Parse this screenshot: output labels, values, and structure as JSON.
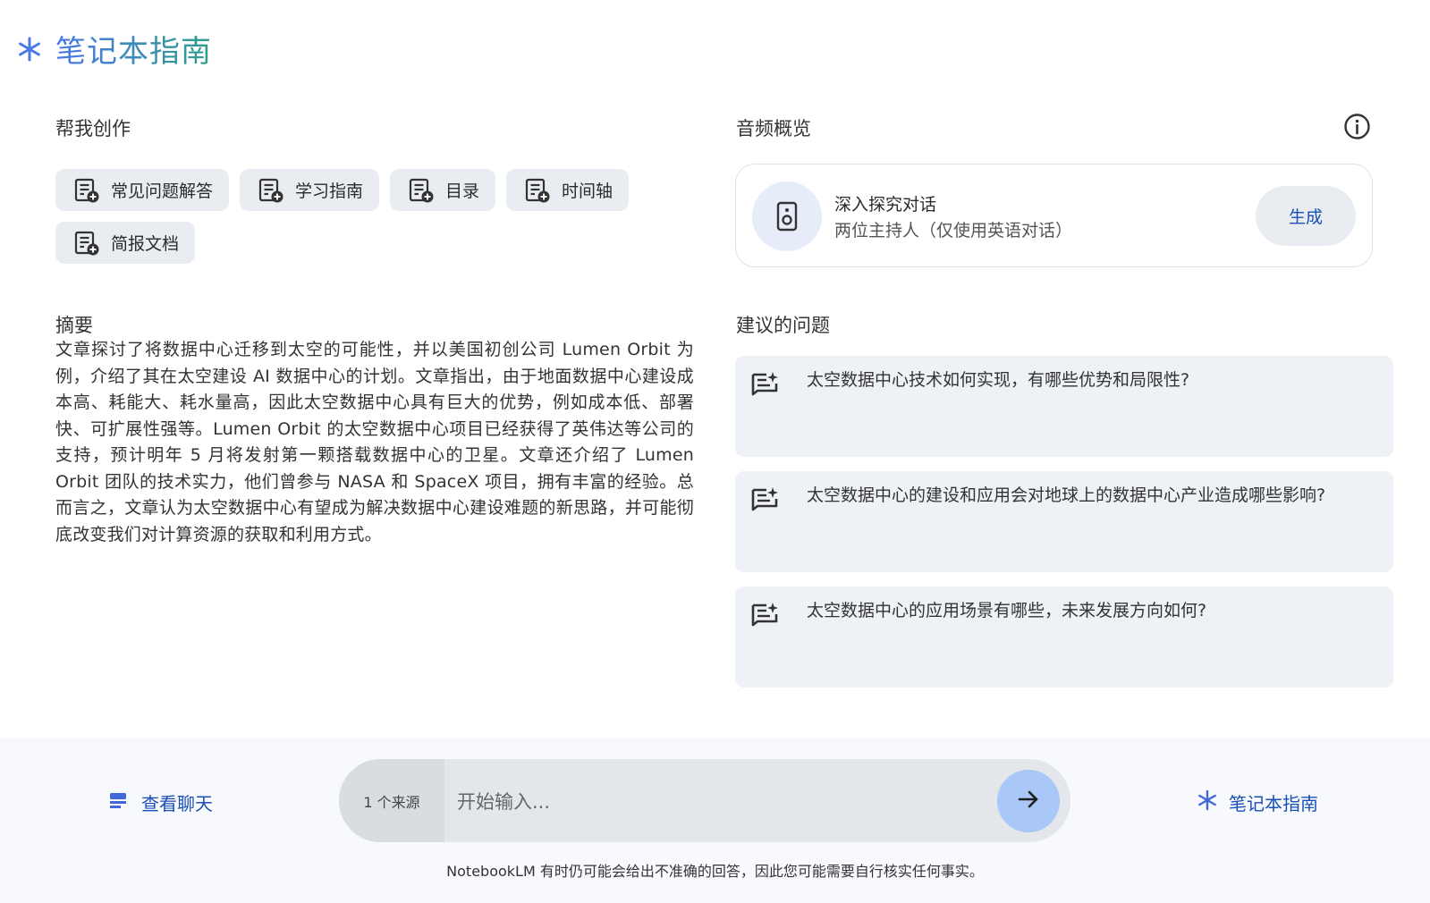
{
  "header": {
    "title": "笔记本指南",
    "icon": "spark-icon"
  },
  "create": {
    "title": "帮我创作",
    "chips": [
      {
        "label": "常见问题解答",
        "icon": "note-add-icon"
      },
      {
        "label": "学习指南",
        "icon": "note-add-icon"
      },
      {
        "label": "目录",
        "icon": "note-add-icon"
      },
      {
        "label": "时间轴",
        "icon": "note-add-icon"
      },
      {
        "label": "简报文档",
        "icon": "note-add-icon"
      }
    ]
  },
  "summary": {
    "title": "摘要",
    "text": "文章探讨了将数据中心迁移到太空的可能性，并以美国初创公司 Lumen Orbit 为例，介绍了其在太空建设 AI 数据中心的计划。文章指出，由于地面数据中心建设成本高、耗能大、耗水量高，因此太空数据中心具有巨大的优势，例如成本低、部署快、可扩展性强等。Lumen Orbit 的太空数据中心项目已经获得了英伟达等公司的支持，预计明年 5 月将发射第一颗搭载数据中心的卫星。文章还介绍了 Lumen Orbit 团队的技术实力，他们曾参与 NASA 和 SpaceX 项目，拥有丰富的经验。总而言之，文章认为太空数据中心有望成为解决数据中心建设难题的新思路，并可能彻底改变我们对计算资源的获取和利用方式。"
  },
  "audio": {
    "title": "音频概览",
    "card_title": "深入探究对话",
    "card_subtitle": "两位主持人（仅使用英语对话）",
    "generate_label": "生成",
    "icons": {
      "info": "info-icon",
      "speaker": "speaker-icon"
    }
  },
  "questions": {
    "title": "建议的问题",
    "items": [
      {
        "text": "太空数据中心技术如何实现，有哪些优势和局限性?"
      },
      {
        "text": "太空数据中心的建设和应用会对地球上的数据中心产业造成哪些影响?"
      },
      {
        "text": "太空数据中心的应用场景有哪些，未来发展方向如何?"
      }
    ]
  },
  "footer": {
    "view_chat_label": "查看聊天",
    "source_count_label": "1 个来源",
    "input_placeholder": "开始输入...",
    "input_value": "",
    "notebook_guide_label": "笔记本指南",
    "disclaimer": "NotebookLM 有时仍可能会给出不准确的回答，因此您可能需要自行核实任何事实。"
  },
  "colors": {
    "accent": "#1a4fb5",
    "title_gradient_start": "#4a78e6",
    "title_gradient_end": "#2f9e89",
    "chip_bg": "#e9edf2",
    "send_button": "#a9c7f7"
  }
}
